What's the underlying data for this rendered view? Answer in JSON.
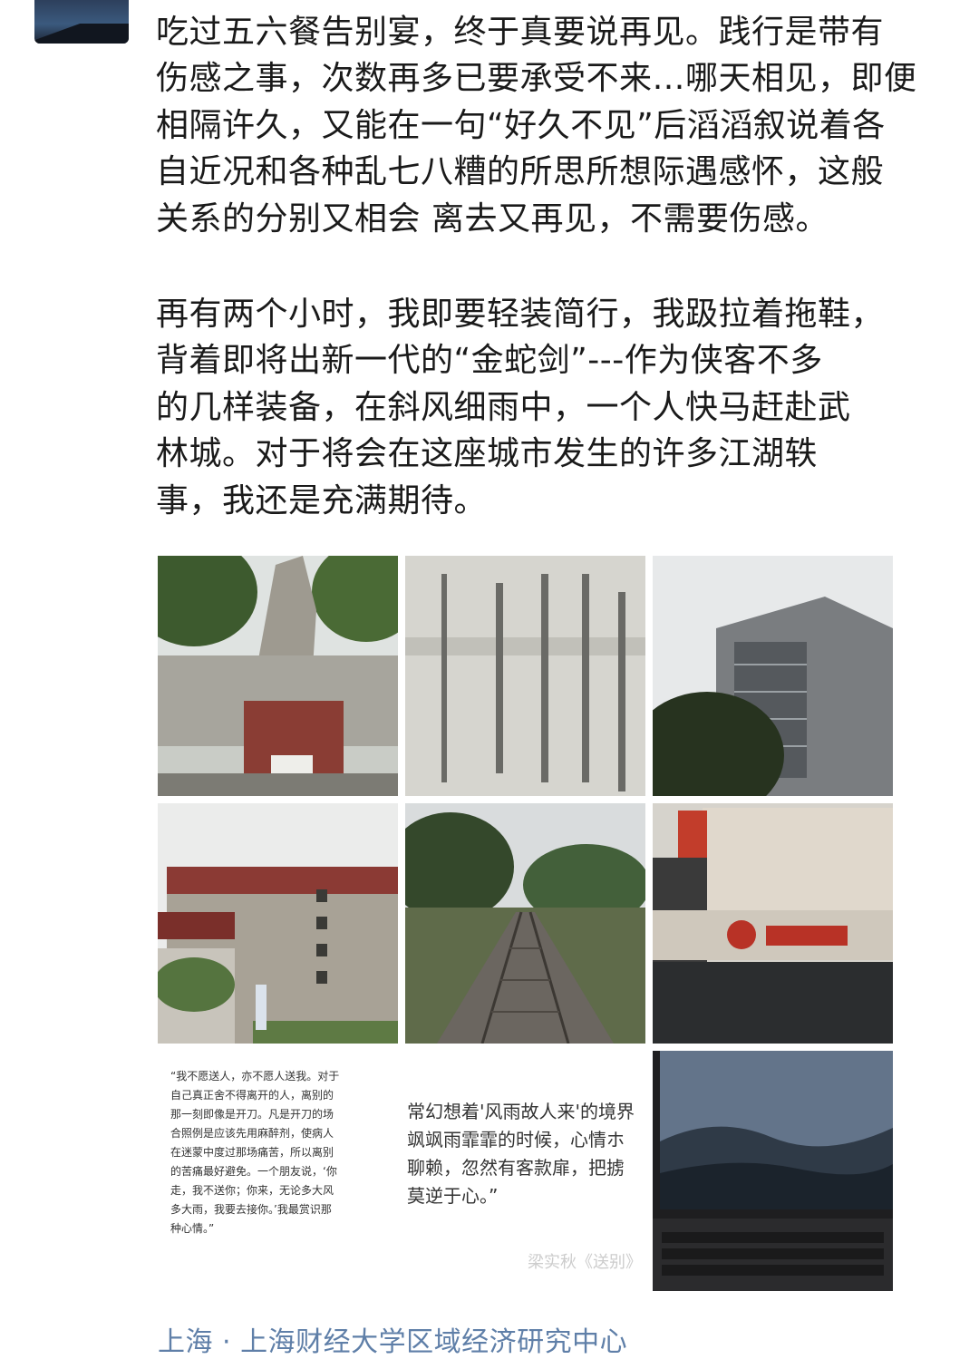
{
  "post": {
    "paragraph1": "吃过五六餐告别宴，终于真要说再见。践行是带有\n伤感之事，次数再多已要承受不来…哪天相见，即便\n相隔许久，又能在一句“好久不见”后滔滔叙说着各\n自近况和各种乱七八糟的所思所想际遇感怀，这般\n关系的分别又相会 离去又再见，不需要伤感。",
    "paragraph2": "再有两个小时，我即要轻装简行，我趿拉着拖鞋，\n背着即将出新一代的“金蛇剑”---作为侠客不多\n的几样装备，在斜风细雨中，一个人快马赶赴武\n林城。对于将会在这座城市发生的许多江湖轶\n事，我还是充满期待。"
  },
  "photos": {
    "quote1": "“我不愿送人，亦不愿人送我。对于\n自己真正舍不得离开的人，离别的\n那一刻即像是开刀。凡是开刀的场\n合照例是应该先用麻醉剂，使病人\n在迷蒙中度过那场痛苦，所以离别\n的苦痛最好避免。一个朋友说，‘你\n走，我不送你；你来，无论多大风\n多大雨，我要去接你。’我最赏识那\n种心情。”",
    "quote2": "常幻想着'风雨故人来'的境界\n飒飒雨霏霏的时候，心情ホ\n聊赖，忽然有客款扉，把掳\n莫逆于心。”",
    "quote2_watermark": "梁实秋《送别》"
  },
  "location": "上海 · 上海财经大学区域经济研究中心",
  "colors": {
    "text": "#1a1a1a",
    "location": "#5f7fa8",
    "background": "#ffffff"
  }
}
